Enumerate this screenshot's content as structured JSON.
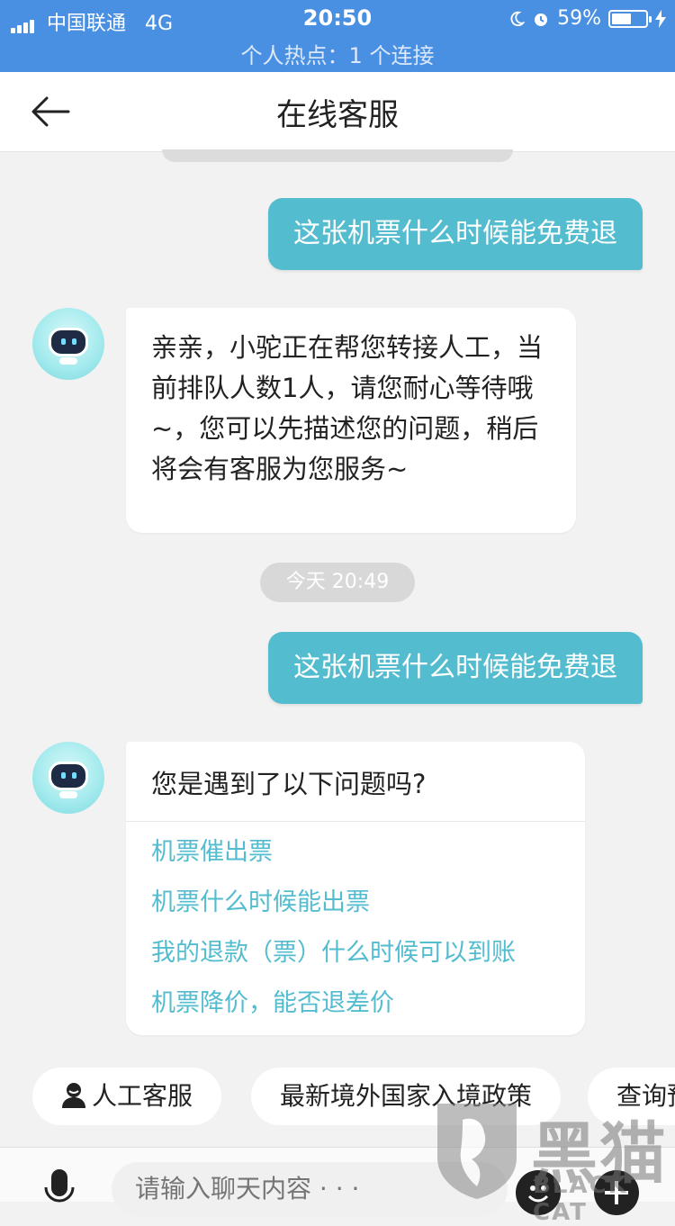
{
  "status_bar": {
    "carrier": "中国联通",
    "network": "4G",
    "time": "20:50",
    "battery_percent": "59%",
    "battery_level": 0.59,
    "hotspot": "个人热点：1 个连接"
  },
  "nav": {
    "title": "在线客服"
  },
  "messages": {
    "out1": "这张机票什么时候能免费退",
    "in1": "亲亲，小驼正在帮您转接人工，当前排队人数1人，请您耐心等待哦~，您可以先描述您的问题，稍后将会有客服为您服务~",
    "timestamp": "今天 20:49",
    "out2": "这张机票什么时候能免费退",
    "question_title": "您是遇到了以下问题吗?",
    "questions": [
      "机票催出票",
      "机票什么时候能出票",
      "我的退款（票）什么时候可以到账",
      "机票降价，能否退差价"
    ]
  },
  "quick_actions": [
    "人工客服",
    "最新境外国家入境政策",
    "查询预"
  ],
  "input": {
    "placeholder": "请输入聊天内容 · · ·"
  },
  "watermark": {
    "brand": "黑猫",
    "sub": "BLACK CAT"
  },
  "colors": {
    "accent": "#53bccf",
    "status_bar": "#4a90e2"
  }
}
